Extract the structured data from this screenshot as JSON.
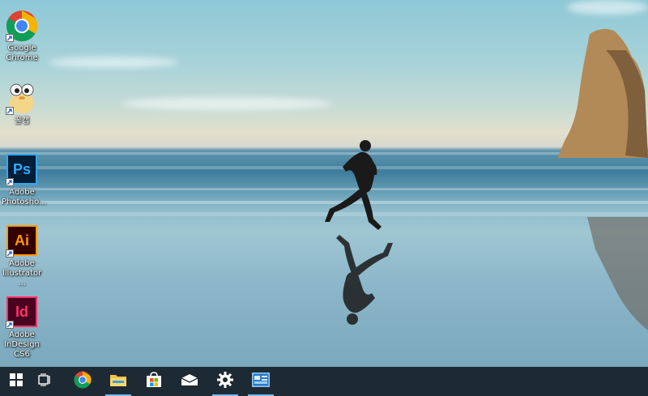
{
  "desktop": {
    "icons": [
      {
        "label": "Google\nChrome",
        "icon": "chrome-icon"
      },
      {
        "label": "꿀캡",
        "icon": "honeycam-icon"
      },
      {
        "label": "Adobe\nPhotosho...",
        "icon": "photoshop-icon",
        "glyph": "Ps"
      },
      {
        "label": "Adobe\nIllustrator ...",
        "icon": "illustrator-icon",
        "glyph": "Ai"
      },
      {
        "label": "Adobe\nInDesign CS6",
        "icon": "indesign-icon",
        "glyph": "Id"
      }
    ]
  },
  "taskbar": {
    "items": [
      {
        "icon": "windows-start-icon",
        "active": false
      },
      {
        "icon": "task-view-icon",
        "active": false
      },
      {
        "icon": "chrome-icon",
        "active": false
      },
      {
        "icon": "file-explorer-icon",
        "active": true
      },
      {
        "icon": "microsoft-store-icon",
        "active": false
      },
      {
        "icon": "mail-icon",
        "active": false
      },
      {
        "icon": "settings-gear-icon",
        "active": true
      },
      {
        "icon": "control-panel-icon",
        "active": true
      }
    ]
  },
  "colors": {
    "taskbar_bg": "#1e2a33",
    "active_indicator": "#76b9ed",
    "photoshop": "#31a8ff",
    "illustrator": "#ff9a00",
    "indesign": "#ff3366"
  }
}
